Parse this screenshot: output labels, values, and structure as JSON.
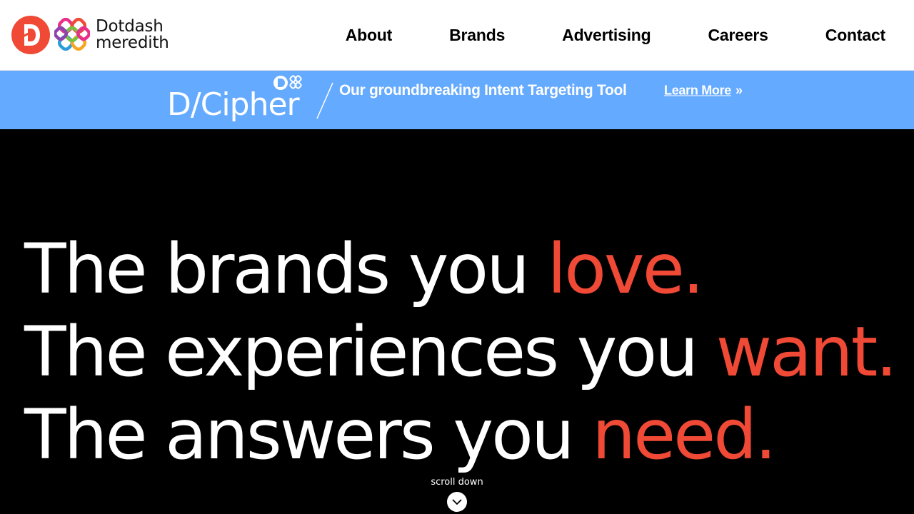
{
  "header": {
    "logo": {
      "line1": "Dotdash",
      "line2": "meredith",
      "mark_icon": "dotdash-d-icon",
      "knot_icon": "meredith-knot-icon",
      "brand_color": "#f04a36"
    },
    "nav": [
      {
        "label": "About"
      },
      {
        "label": "Brands"
      },
      {
        "label": "Advertising"
      },
      {
        "label": "Careers"
      },
      {
        "label": "Contact"
      }
    ]
  },
  "banner": {
    "product_name": "D/Cipher",
    "tagline": "Our groundbreaking Intent Targeting Tool",
    "link_label": "Learn More",
    "link_suffix": "»",
    "background": "#64aaff"
  },
  "hero": {
    "lines": [
      {
        "lead": "The brands you ",
        "accent": "love."
      },
      {
        "lead": "The experiences you ",
        "accent": "want."
      },
      {
        "lead": "The answers you ",
        "accent": "need."
      }
    ],
    "accent_color": "#f04a36",
    "scroll_label": "scroll down",
    "scroll_icon": "chevron-down-icon"
  }
}
